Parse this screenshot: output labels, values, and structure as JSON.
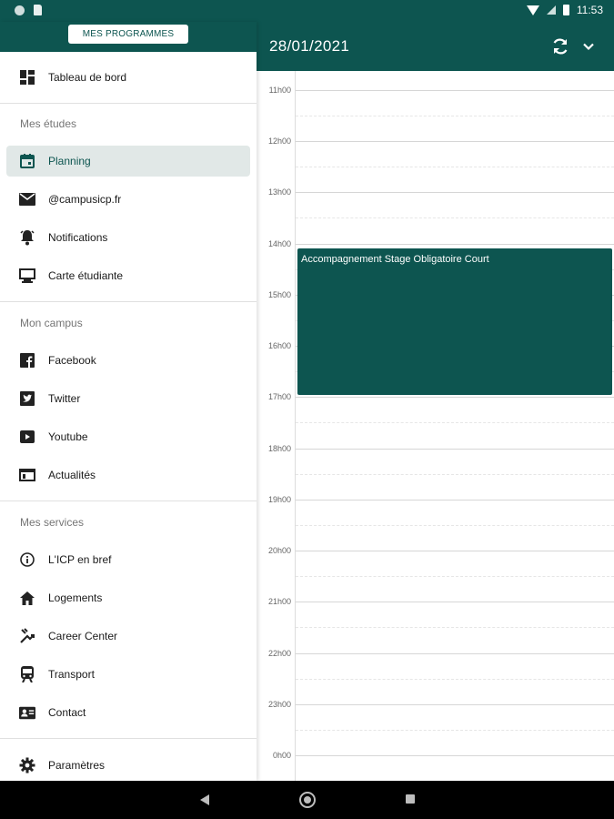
{
  "status_bar": {
    "time": "11:53"
  },
  "drawer": {
    "programs_button": "MES PROGRAMMES",
    "top_items": [
      {
        "label": "Tableau de bord",
        "icon": "dashboard-icon"
      }
    ],
    "sections": [
      {
        "title": "Mes études",
        "items": [
          {
            "label": "Planning",
            "icon": "calendar-icon",
            "active": true
          },
          {
            "label": "@campusicp.fr",
            "icon": "mail-icon"
          },
          {
            "label": "Notifications",
            "icon": "bell-icon"
          },
          {
            "label": "Carte étudiante",
            "icon": "student-card-icon"
          }
        ]
      },
      {
        "title": "Mon campus",
        "items": [
          {
            "label": "Facebook",
            "icon": "facebook-icon"
          },
          {
            "label": "Twitter",
            "icon": "twitter-icon"
          },
          {
            "label": "Youtube",
            "icon": "youtube-icon"
          },
          {
            "label": "Actualités",
            "icon": "news-icon"
          }
        ]
      },
      {
        "title": "Mes services",
        "items": [
          {
            "label": "L'ICP en bref",
            "icon": "info-icon"
          },
          {
            "label": "Logements",
            "icon": "home-icon"
          },
          {
            "label": "Career Center",
            "icon": "career-icon"
          },
          {
            "label": "Transport",
            "icon": "train-icon"
          },
          {
            "label": "Contact",
            "icon": "contact-card-icon"
          }
        ]
      }
    ],
    "bottom_items": [
      {
        "label": "Paramètres",
        "icon": "gear-icon"
      }
    ]
  },
  "header": {
    "date": "28/01/2021",
    "refresh_icon": "refresh-icon",
    "expand_icon": "chevron-down-icon"
  },
  "calendar": {
    "hours": [
      "11h00",
      "12h00",
      "13h00",
      "14h00",
      "15h00",
      "16h00",
      "17h00",
      "18h00",
      "19h00",
      "20h00",
      "21h00",
      "22h00",
      "23h00",
      "0h00"
    ],
    "events": [
      {
        "title": "Accompagnement Stage Obligatoire Court",
        "start": "14h00",
        "end": "17h00"
      }
    ]
  },
  "colors": {
    "primary": "#0d5550",
    "active_item_bg": "#e1e8e7"
  }
}
